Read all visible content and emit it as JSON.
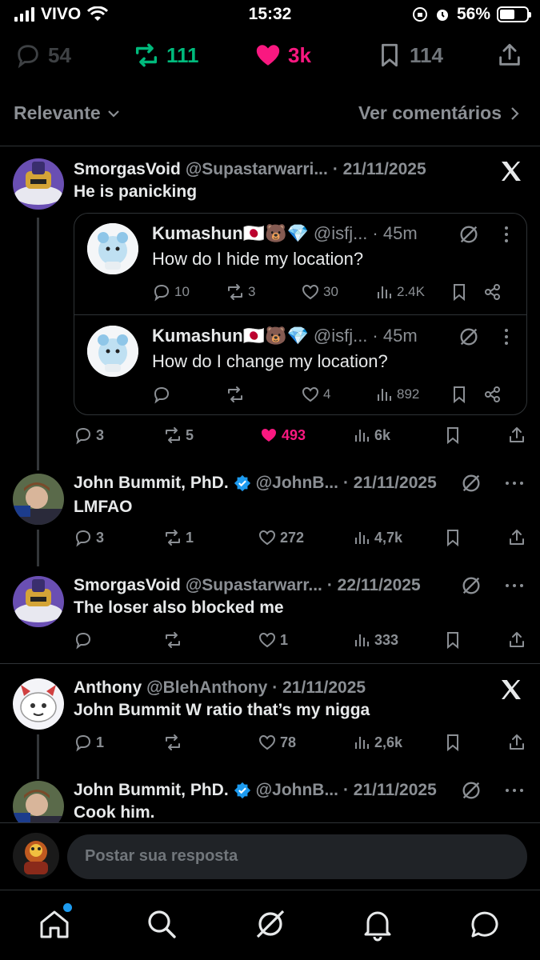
{
  "status_bar": {
    "carrier": "VIVO",
    "time": "15:32",
    "battery": "56%",
    "battery_level": 0.56
  },
  "action_bar": {
    "replies": "54",
    "reposts": "111",
    "likes": "3k",
    "bookmarks": "114"
  },
  "sort": {
    "label": "Relevante",
    "view_comments": "Ver comentários"
  },
  "posts": [
    {
      "name": "SmorgasVoid",
      "handle": "@Supastarwarri...",
      "date": "· 21/11/2025",
      "text": "He is panicking",
      "stats": {
        "replies": "3",
        "reposts": "5",
        "likes": "493",
        "views": "6k"
      },
      "quotes": [
        {
          "name": "Kumashun🇯🇵🐻💎",
          "handle": "@isfj...",
          "time": "· 45m",
          "text": "How do I hide my location?",
          "stats": {
            "replies": "10",
            "reposts": "3",
            "likes": "30",
            "views": "2.4K"
          }
        },
        {
          "name": "Kumashun🇯🇵🐻💎",
          "handle": "@isfj...",
          "time": "· 45m",
          "text": "How do I change my location?",
          "stats": {
            "replies": "",
            "reposts": "",
            "likes": "4",
            "views": "892"
          }
        }
      ]
    },
    {
      "name": "John Bummit, PhD.",
      "handle": "@JohnB...",
      "date": "· 21/11/2025",
      "text": "LMFAO",
      "stats": {
        "replies": "3",
        "reposts": "1",
        "likes": "272",
        "views": "4,7k"
      }
    },
    {
      "name": "SmorgasVoid",
      "handle": "@Supastarwarr...",
      "date": "· 22/11/2025",
      "text": "The loser also blocked me",
      "stats": {
        "replies": "",
        "reposts": "",
        "likes": "1",
        "views": "333"
      }
    },
    {
      "name": "Anthony",
      "handle": "@BlehAnthony",
      "date": "· 21/11/2025",
      "text": "John Bummit W ratio that’s my nigga",
      "stats": {
        "replies": "1",
        "reposts": "",
        "likes": "78",
        "views": "2,6k"
      }
    },
    {
      "name": "John Bummit, PhD.",
      "handle": "@JohnB...",
      "date": "· 21/11/2025",
      "text": "Cook him."
    }
  ],
  "reply": {
    "placeholder": "Postar sua resposta"
  },
  "colors": {
    "repost": "#00ba7c",
    "like": "#f91880",
    "verified": "#1d9bf0",
    "muted": "#8b8f94"
  }
}
